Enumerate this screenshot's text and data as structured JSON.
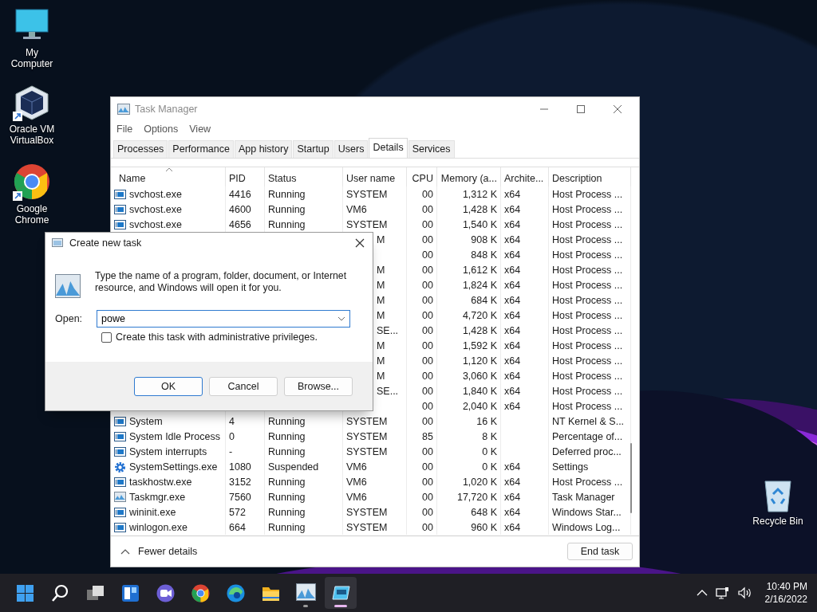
{
  "desktop_icons": [
    {
      "kind": "computer",
      "label": "My Computer",
      "shortcut": false
    },
    {
      "kind": "vbox",
      "label": "Oracle VM VirtualBox",
      "shortcut": true
    },
    {
      "kind": "chrome",
      "label": "Google Chrome",
      "shortcut": true
    },
    {
      "kind": "recycle",
      "label": "Recycle Bin",
      "shortcut": false
    }
  ],
  "task_manager": {
    "title": "Task Manager",
    "menu": [
      "File",
      "Options",
      "View"
    ],
    "tabs": [
      {
        "label": "Processes",
        "selected": false
      },
      {
        "label": "Performance",
        "selected": false
      },
      {
        "label": "App history",
        "selected": false
      },
      {
        "label": "Startup",
        "selected": false
      },
      {
        "label": "Users",
        "selected": false
      },
      {
        "label": "Details",
        "selected": true
      },
      {
        "label": "Services",
        "selected": false
      }
    ],
    "columns": [
      {
        "label": "Name",
        "sorted": true
      },
      {
        "label": "PID",
        "sorted": false
      },
      {
        "label": "Status",
        "sorted": false
      },
      {
        "label": "User name",
        "sorted": false
      },
      {
        "label": "CPU",
        "sorted": false
      },
      {
        "label": "Memory (a...",
        "sorted": false
      },
      {
        "label": "Archite...",
        "sorted": false
      },
      {
        "label": "Description",
        "sorted": false
      }
    ],
    "rows": [
      {
        "kind": "service",
        "cells": [
          "svchost.exe",
          "4416",
          "Running",
          "SYSTEM",
          "00",
          "1,312 K",
          "x64",
          "Host Process ..."
        ]
      },
      {
        "kind": "service",
        "cells": [
          "svchost.exe",
          "4600",
          "Running",
          "VM6",
          "00",
          "1,428 K",
          "x64",
          "Host Process ..."
        ]
      },
      {
        "kind": "service",
        "cells": [
          "svchost.exe",
          "4656",
          "Running",
          "SYSTEM",
          "00",
          "1,540 K",
          "x64",
          "Host Process ..."
        ]
      },
      {
        "kind": "covered",
        "cells": [
          null,
          null,
          null,
          "M",
          "00",
          "908 K",
          "x64",
          "Host Process ..."
        ]
      },
      {
        "kind": "covered",
        "cells": [
          null,
          null,
          null,
          null,
          "00",
          "848 K",
          "x64",
          "Host Process ..."
        ]
      },
      {
        "kind": "covered",
        "cells": [
          null,
          null,
          null,
          "M",
          "00",
          "1,612 K",
          "x64",
          "Host Process ..."
        ]
      },
      {
        "kind": "covered",
        "cells": [
          null,
          null,
          null,
          "M",
          "00",
          "1,824 K",
          "x64",
          "Host Process ..."
        ]
      },
      {
        "kind": "covered",
        "cells": [
          null,
          null,
          null,
          "M",
          "00",
          "684 K",
          "x64",
          "Host Process ..."
        ]
      },
      {
        "kind": "covered",
        "cells": [
          null,
          null,
          null,
          "M",
          "00",
          "4,720 K",
          "x64",
          "Host Process ..."
        ]
      },
      {
        "kind": "covered",
        "cells": [
          null,
          null,
          null,
          "SE...",
          "00",
          "1,428 K",
          "x64",
          "Host Process ..."
        ]
      },
      {
        "kind": "covered",
        "cells": [
          null,
          null,
          null,
          "M",
          "00",
          "1,592 K",
          "x64",
          "Host Process ..."
        ]
      },
      {
        "kind": "covered",
        "cells": [
          null,
          null,
          null,
          "M",
          "00",
          "1,120 K",
          "x64",
          "Host Process ..."
        ]
      },
      {
        "kind": "covered",
        "cells": [
          null,
          null,
          null,
          "M",
          "00",
          "3,060 K",
          "x64",
          "Host Process ..."
        ]
      },
      {
        "kind": "covered",
        "cells": [
          null,
          null,
          null,
          "SE...",
          "00",
          "1,840 K",
          "x64",
          "Host Process ..."
        ]
      },
      {
        "kind": "covered",
        "cells": [
          null,
          null,
          null,
          null,
          "00",
          "2,040 K",
          "x64",
          "Host Process ..."
        ]
      },
      {
        "kind": "service",
        "cells": [
          "System",
          "4",
          "Running",
          "SYSTEM",
          "00",
          "16 K",
          null,
          "NT Kernel & S..."
        ]
      },
      {
        "kind": "service",
        "cells": [
          "System Idle Process",
          "0",
          "Running",
          "SYSTEM",
          "85",
          "8 K",
          null,
          "Percentage of..."
        ]
      },
      {
        "kind": "service",
        "cells": [
          "System interrupts",
          "-",
          "Running",
          "SYSTEM",
          "00",
          "0 K",
          null,
          "Deferred proc..."
        ]
      },
      {
        "kind": "settings",
        "cells": [
          "SystemSettings.exe",
          "1080",
          "Suspended",
          "VM6",
          "00",
          "0 K",
          "x64",
          "Settings"
        ]
      },
      {
        "kind": "service",
        "cells": [
          "taskhostw.exe",
          "3152",
          "Running",
          "VM6",
          "00",
          "1,020 K",
          "x64",
          "Host Process ..."
        ]
      },
      {
        "kind": "taskmgr",
        "cells": [
          "Taskmgr.exe",
          "7560",
          "Running",
          "VM6",
          "00",
          "17,720 K",
          "x64",
          "Task Manager"
        ]
      },
      {
        "kind": "service",
        "cells": [
          "wininit.exe",
          "572",
          "Running",
          "SYSTEM",
          "00",
          "648 K",
          "x64",
          "Windows Star..."
        ]
      },
      {
        "kind": "service",
        "cells": [
          "winlogon.exe",
          "664",
          "Running",
          "SYSTEM",
          "00",
          "960 K",
          "x64",
          "Windows Log..."
        ]
      }
    ],
    "footer": {
      "toggle": "Fewer details",
      "button": "End task"
    }
  },
  "dialog": {
    "title": "Create new task",
    "message": "Type the name of a program, folder, document, or Internet resource, and Windows will open it for you.",
    "open_label": "Open:",
    "open_value": "powe",
    "checkbox": {
      "label": "Create this task with administrative privileges.",
      "checked": false
    },
    "buttons": [
      {
        "label": "OK",
        "default": true
      },
      {
        "label": "Cancel",
        "default": false
      },
      {
        "label": "Browse...",
        "default": false
      }
    ]
  },
  "taskbar": {
    "apps": [
      {
        "kind": "start",
        "running": false,
        "selected": false
      },
      {
        "kind": "search",
        "running": false,
        "selected": false
      },
      {
        "kind": "taskview",
        "running": false,
        "selected": false
      },
      {
        "kind": "widgets",
        "running": false,
        "selected": false
      },
      {
        "kind": "chat",
        "running": false,
        "selected": false
      },
      {
        "kind": "chrome",
        "running": false,
        "selected": false
      },
      {
        "kind": "edge",
        "running": false,
        "selected": false
      },
      {
        "kind": "folder",
        "running": false,
        "selected": false
      },
      {
        "kind": "taskmgr",
        "running": true,
        "selected": false
      },
      {
        "kind": "vbox",
        "running": true,
        "selected": true
      }
    ],
    "clock": {
      "time": "10:40 PM",
      "date": "2/16/2022"
    }
  }
}
